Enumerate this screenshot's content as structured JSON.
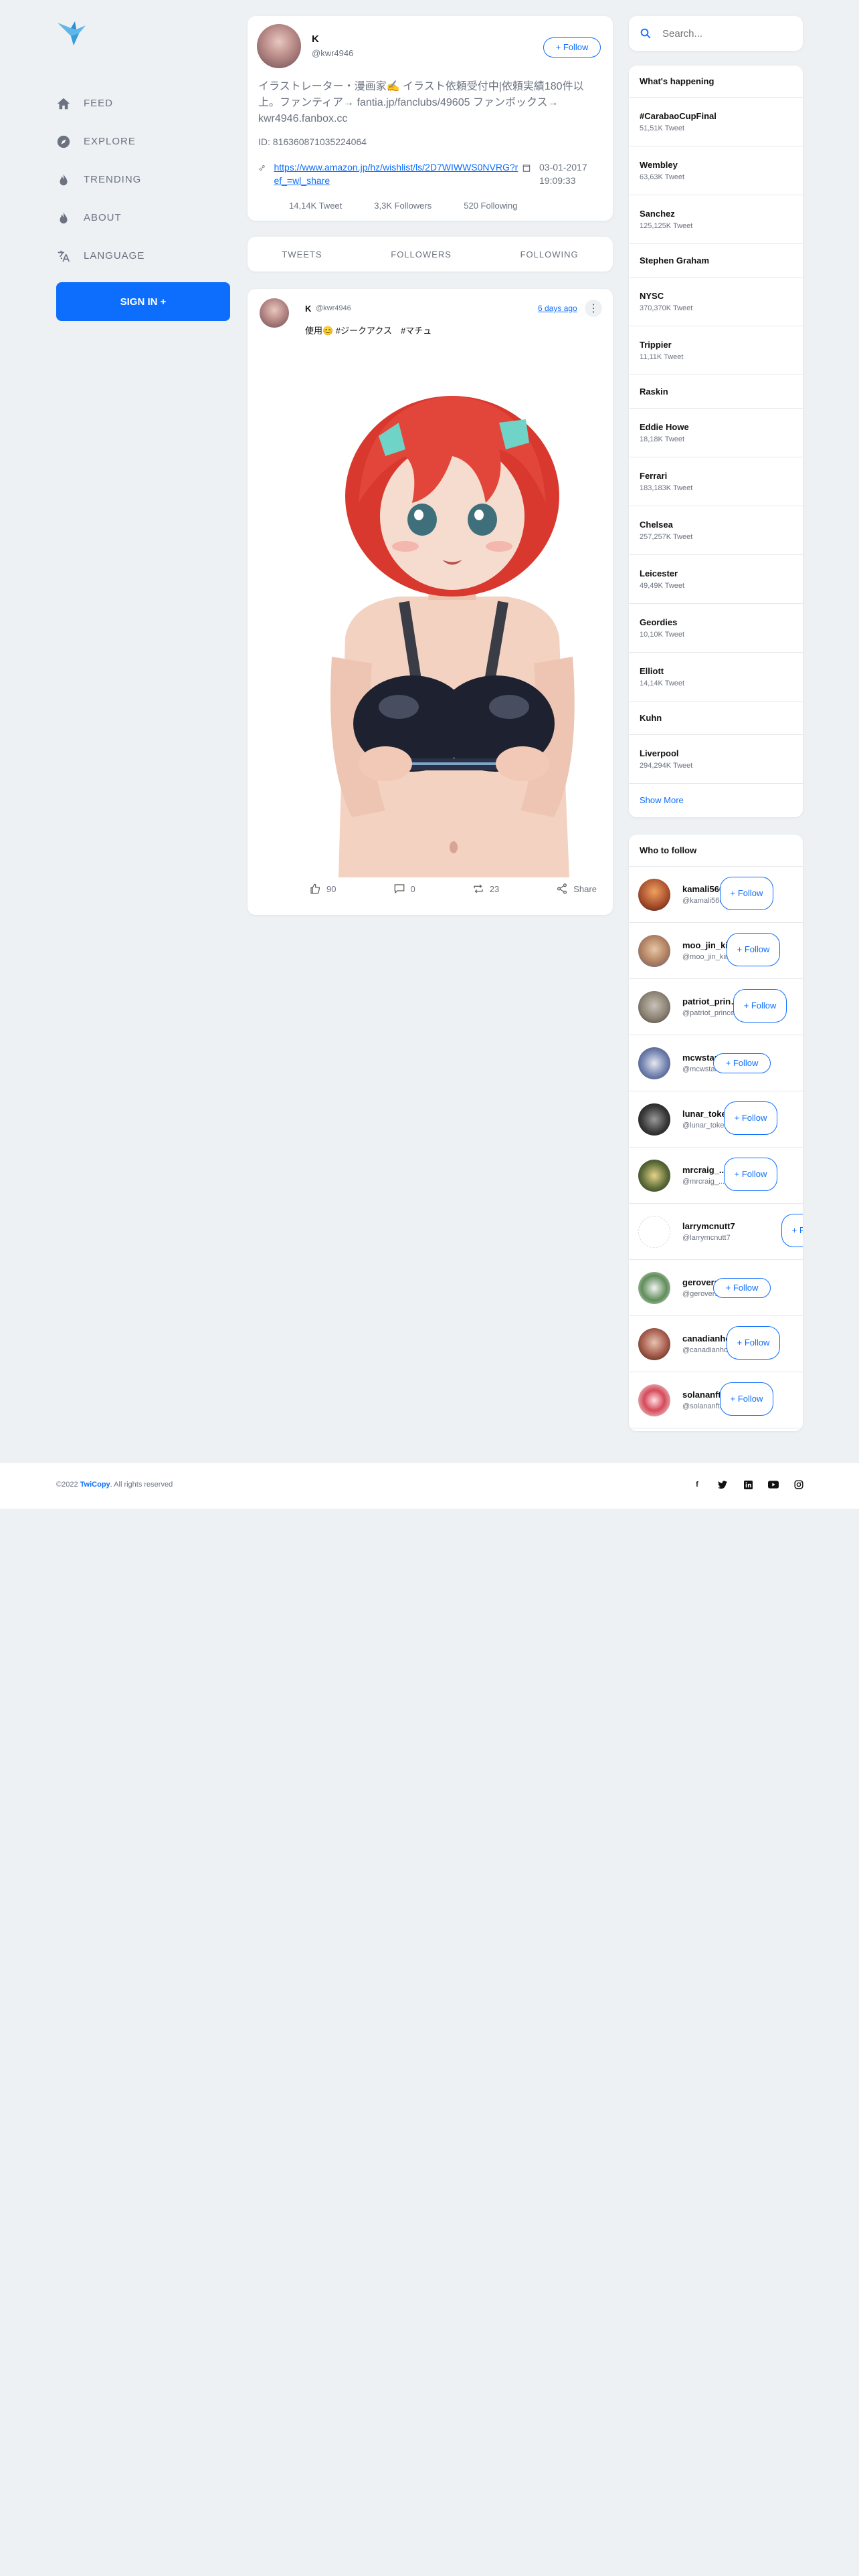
{
  "brand": {
    "accent": "#0d6efd",
    "name": "TwiCopy"
  },
  "nav": {
    "items": [
      {
        "label": "FEED",
        "icon": "home-icon"
      },
      {
        "label": "EXPLORE",
        "icon": "compass-icon"
      },
      {
        "label": "TRENDING",
        "icon": "flame-icon"
      },
      {
        "label": "ABOUT",
        "icon": "flame-icon"
      },
      {
        "label": "LANGUAGE",
        "icon": "translate-icon"
      }
    ],
    "sign_in": "SIGN IN +"
  },
  "profile": {
    "name": "K",
    "handle": "@kwr4946",
    "follow": "+ Follow",
    "bio": "イラストレーター・漫画家✍ イラスト依頼受付中|依頼実績180件以上。ファンティア→ fantia.jp/fanclubs/49605 ファンボックス→ kwr4946.fanbox.cc",
    "id_label": "ID:",
    "id": "816360871035224064",
    "link": "https://www.amazon.jp/hz/wishlist/ls/2D7WIWWS0NVRG?ref_=wl_share",
    "date": "03-01-2017 19:09:33",
    "tweets": "14,14K Tweet",
    "followers": "3,3K Followers",
    "following": "520 Following"
  },
  "tabs": [
    "TWEETS",
    "FOLLOWERS",
    "FOLLOWING"
  ],
  "tweet": {
    "name": "K",
    "handle": "@kwr4946",
    "time": "6 days ago",
    "text": "使用😊 #ジークアクス　#マチュ",
    "likes": "90",
    "comments": "0",
    "retweets": "23",
    "share": "Share"
  },
  "search": {
    "placeholder": "Search..."
  },
  "trends": {
    "title": "What's happening",
    "items": [
      {
        "name": "#CarabaoCupFinal",
        "count": "51,51K Tweet"
      },
      {
        "name": "Wembley",
        "count": "63,63K Tweet"
      },
      {
        "name": "Sanchez",
        "count": "125,125K Tweet"
      },
      {
        "name": "Stephen Graham",
        "count": ""
      },
      {
        "name": "NYSC",
        "count": "370,370K Tweet"
      },
      {
        "name": "Trippier",
        "count": "11,11K Tweet"
      },
      {
        "name": "Raskin",
        "count": ""
      },
      {
        "name": "Eddie Howe",
        "count": "18,18K Tweet"
      },
      {
        "name": "Ferrari",
        "count": "183,183K Tweet"
      },
      {
        "name": "Chelsea",
        "count": "257,257K Tweet"
      },
      {
        "name": "Leicester",
        "count": "49,49K Tweet"
      },
      {
        "name": "Geordies",
        "count": "10,10K Tweet"
      },
      {
        "name": "Elliott",
        "count": "14,14K Tweet"
      },
      {
        "name": "Kuhn",
        "count": ""
      },
      {
        "name": "Liverpool",
        "count": "294,294K Tweet"
      }
    ],
    "show_more": "Show More"
  },
  "who_to_follow": {
    "title": "Who to follow",
    "follow_label": "+ Follow",
    "users": [
      {
        "name": "kamali566",
        "handle": "@kamali566"
      },
      {
        "name": "moo_jin_kim",
        "handle": "@moo_jin_kim"
      },
      {
        "name": "patriot_princes",
        "handle": "@patriot_princes"
      },
      {
        "name": "mcwstarz",
        "handle": "@mcwstarz"
      },
      {
        "name": "lunar_token",
        "handle": "@lunar_token"
      },
      {
        "name": "mrcraig_...",
        "handle": "@mrcraig_..."
      },
      {
        "name": "larrymcnutt7",
        "handle": "@larrymcnutt7"
      },
      {
        "name": "gerovers",
        "handle": "@gerovers"
      },
      {
        "name": "canadianhom",
        "handle": "@canadianhom"
      },
      {
        "name": "solananft3",
        "handle": "@solananft3"
      }
    ]
  },
  "footer": {
    "year": "©2022",
    "brand": "TwiCopy",
    "rights": ". All rights reserved"
  }
}
